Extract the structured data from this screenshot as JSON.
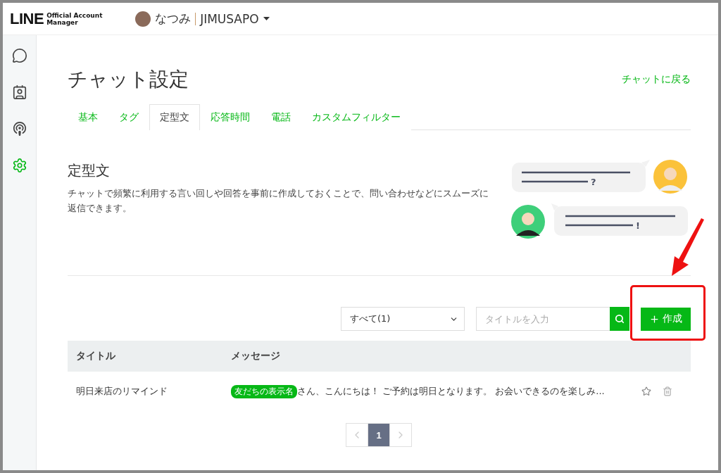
{
  "header": {
    "logo_main": "LINE",
    "logo_sub": "Official Account Manager",
    "account_name": "なつみ",
    "account_id": "JIMUSAPO"
  },
  "sidebar": {
    "items": [
      {
        "selected": false
      },
      {
        "selected": false
      },
      {
        "selected": false
      },
      {
        "selected": true
      }
    ]
  },
  "page": {
    "title": "チャット設定",
    "back_link": "チャットに戻る"
  },
  "tabs": [
    {
      "label": "基本",
      "selected": false
    },
    {
      "label": "タグ",
      "selected": false
    },
    {
      "label": "定型文",
      "selected": true
    },
    {
      "label": "応答時間",
      "selected": false
    },
    {
      "label": "電話",
      "selected": false
    },
    {
      "label": "カスタムフィルター",
      "selected": false
    }
  ],
  "section": {
    "title": "定型文",
    "description": "チャットで頻繁に利用する言い回しや回答を事前に作成しておくことで、問い合わせなどにスムーズに返信できます。",
    "bubble_marks": [
      "?",
      "!"
    ]
  },
  "filter": {
    "value": "すべて(1)"
  },
  "search": {
    "placeholder": "タイトルを入力"
  },
  "create_button": "作成",
  "table": {
    "columns": [
      "タイトル",
      "メッセージ"
    ],
    "rows": [
      {
        "title": "明日来店のリマインド",
        "message_tag": "友だちの表示名",
        "message": "さん、こんにちは！ ご予約は明日となります。 お会いできるのを楽しみ...",
        "starred": false
      }
    ]
  },
  "pagination": {
    "pages": [
      {
        "label": "1",
        "selected": true
      }
    ]
  }
}
